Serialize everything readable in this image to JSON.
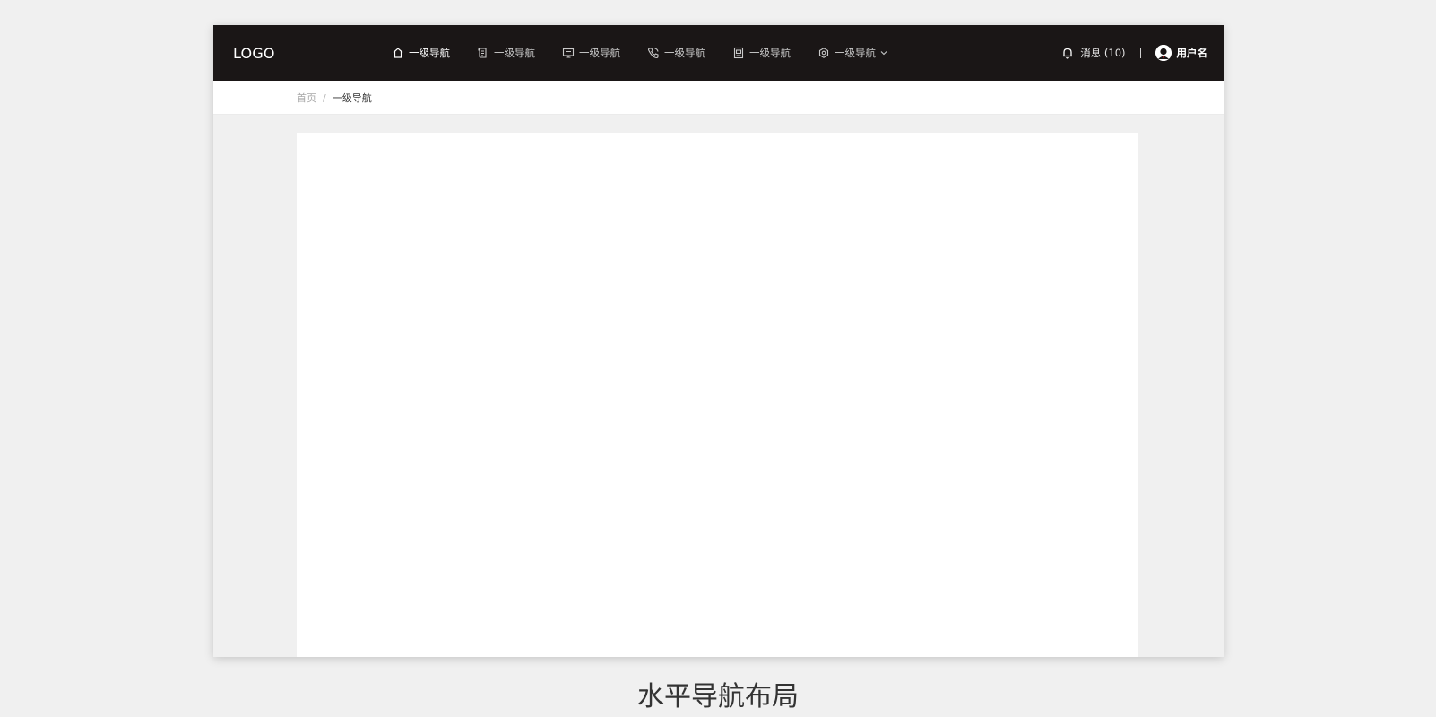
{
  "header": {
    "logo": "LOGO",
    "nav": [
      {
        "label": "一级导航",
        "icon": "home-icon",
        "active": true
      },
      {
        "label": "一级导航",
        "icon": "document-icon",
        "active": false
      },
      {
        "label": "一级导航",
        "icon": "monitor-icon",
        "active": false
      },
      {
        "label": "一级导航",
        "icon": "phone-icon",
        "active": false
      },
      {
        "label": "一级导航",
        "icon": "image-icon",
        "active": false
      },
      {
        "label": "一级导航",
        "icon": "gear-icon",
        "active": false,
        "dropdown": true
      }
    ],
    "messages_label": "消息 (10)",
    "user_name": "用户名"
  },
  "breadcrumb": {
    "home": "首页",
    "separator": "/",
    "current": "一级导航"
  },
  "caption": "水平导航布局",
  "colors": {
    "header_bg": "#1a1616",
    "page_bg": "#f0f0f0",
    "content_bg": "#ffffff",
    "accent_red": "#e02020"
  }
}
